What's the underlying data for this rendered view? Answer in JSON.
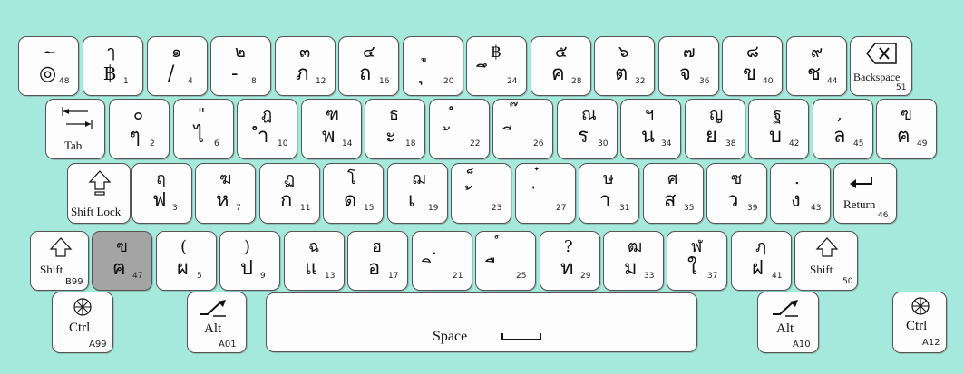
{
  "keyboard": {
    "rows": [
      {
        "keys": [
          {
            "id": "k48",
            "shift": "~",
            "base": "◎",
            "code": "48"
          },
          {
            "id": "k1",
            "shift": "ๅ",
            "base": "฿",
            "code": "1"
          },
          {
            "id": "k4",
            "shift": "๑",
            "base": "/",
            "code": "4"
          },
          {
            "id": "k8",
            "shift": "๒",
            "base": "-",
            "code": "8"
          },
          {
            "id": "k12",
            "shift": "๓",
            "base": "ภ",
            "code": "12"
          },
          {
            "id": "k16",
            "shift": "๔",
            "base": "ถ",
            "code": "16"
          },
          {
            "id": "k20",
            "shift": "ู",
            "base": "ุ",
            "code": "20"
          },
          {
            "id": "k24",
            "shift": "฿",
            "base": "ึ",
            "code": "24"
          },
          {
            "id": "k28",
            "shift": "๕",
            "base": "ค",
            "code": "28"
          },
          {
            "id": "k32",
            "shift": "๖",
            "base": "ต",
            "code": "32"
          },
          {
            "id": "k36",
            "shift": "๗",
            "base": "จ",
            "code": "36"
          },
          {
            "id": "k40",
            "shift": "๘",
            "base": "ข",
            "code": "40"
          },
          {
            "id": "k44",
            "shift": "๙",
            "base": "ช",
            "code": "44"
          }
        ],
        "backspace": {
          "label": "Backspace",
          "code": "51"
        }
      },
      {
        "tab": {
          "label": "Tab"
        },
        "keys": [
          {
            "id": "k2",
            "shift": "๐",
            "base": "ๆ",
            "code": "2"
          },
          {
            "id": "k6",
            "shift": "\"",
            "base": "ไ",
            "code": "6"
          },
          {
            "id": "k10",
            "shift": "ฎ",
            "base": "ำ",
            "code": "10"
          },
          {
            "id": "k14",
            "shift": "ฑ",
            "base": "พ",
            "code": "14"
          },
          {
            "id": "k18",
            "shift": "ธ",
            "base": "ะ",
            "code": "18"
          },
          {
            "id": "k22",
            "shift": "ํ",
            "base": "ั",
            "code": "22"
          },
          {
            "id": "k26",
            "shift": "๊",
            "base": "ี",
            "code": "26"
          },
          {
            "id": "k30",
            "shift": "ณ",
            "base": "ร",
            "code": "30"
          },
          {
            "id": "k34",
            "shift": "ฯ",
            "base": "น",
            "code": "34"
          },
          {
            "id": "k38",
            "shift": "ญ",
            "base": "ย",
            "code": "38"
          },
          {
            "id": "k42",
            "shift": "ฐ",
            "base": "บ",
            "code": "42"
          },
          {
            "id": "k45",
            "shift": ",",
            "base": "ล",
            "code": "45"
          },
          {
            "id": "k49",
            "shift": "ฃ",
            "base": "ฅ",
            "code": "49"
          }
        ]
      },
      {
        "shift_lock": {
          "label": "Shift Lock"
        },
        "keys": [
          {
            "id": "k3",
            "shift": "ฤ",
            "base": "ฟ",
            "code": "3"
          },
          {
            "id": "k7",
            "shift": "ฆ",
            "base": "ห",
            "code": "7"
          },
          {
            "id": "k11",
            "shift": "ฏ",
            "base": "ก",
            "code": "11"
          },
          {
            "id": "k15",
            "shift": "โ",
            "base": "ด",
            "code": "15"
          },
          {
            "id": "k19",
            "shift": "ฌ",
            "base": "เ",
            "code": "19"
          },
          {
            "id": "k23",
            "shift": "็",
            "base": "้",
            "code": "23"
          },
          {
            "id": "k27",
            "shift": "๋",
            "base": "่",
            "code": "27"
          },
          {
            "id": "k31",
            "shift": "ษ",
            "base": "า",
            "code": "31"
          },
          {
            "id": "k35",
            "shift": "ศ",
            "base": "ส",
            "code": "35"
          },
          {
            "id": "k39",
            "shift": "ซ",
            "base": "ว",
            "code": "39"
          },
          {
            "id": "k43",
            "shift": ".",
            "base": "ง",
            "code": "43"
          }
        ],
        "return": {
          "label": "Return",
          "code": "46"
        }
      },
      {
        "shift_left": {
          "label": "Shift",
          "code": "B99"
        },
        "keys": [
          {
            "id": "k47",
            "shift": "ฃ",
            "base": "ฅ",
            "code": "47",
            "gray": true
          },
          {
            "id": "k5",
            "shift": "(",
            "base": "ผ",
            "code": "5"
          },
          {
            "id": "k9",
            "shift": ")",
            "base": "ป",
            "code": "9"
          },
          {
            "id": "k13",
            "shift": "ฉ",
            "base": "แ",
            "code": "13"
          },
          {
            "id": "k17",
            "shift": "ฮ",
            "base": "อ",
            "code": "17"
          },
          {
            "id": "k21",
            "shift": "ฺ",
            "base": "ิ",
            "code": "21"
          },
          {
            "id": "k25",
            "shift": "์",
            "base": "ื",
            "code": "25"
          },
          {
            "id": "k29",
            "shift": "?",
            "base": "ท",
            "code": "29"
          },
          {
            "id": "k33",
            "shift": "ฒ",
            "base": "ม",
            "code": "33"
          },
          {
            "id": "k37",
            "shift": "ฬ",
            "base": "ใ",
            "code": "37"
          },
          {
            "id": "k41",
            "shift": "ฦ",
            "base": "ฝ",
            "code": "41"
          }
        ],
        "shift_right": {
          "label": "Shift",
          "code": "50"
        }
      },
      {
        "ctrl_left": {
          "label": "Ctrl",
          "code": "A99"
        },
        "alt_left": {
          "label": "Alt",
          "code": "A01"
        },
        "space": {
          "label": "Space"
        },
        "alt_right": {
          "label": "Alt",
          "code": "A10"
        },
        "ctrl_right": {
          "label": "Ctrl",
          "code": "A12"
        }
      }
    ]
  }
}
